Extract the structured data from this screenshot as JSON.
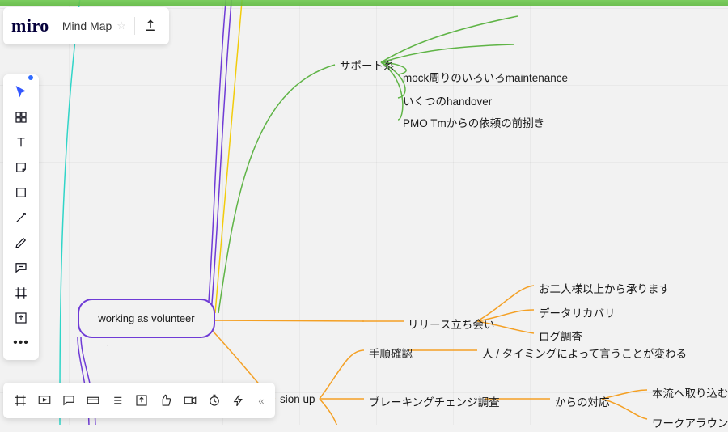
{
  "app": {
    "logo": "miro",
    "board_name": "Mind Map"
  },
  "colors": {
    "green": "#5fb446",
    "orange": "#f4a024",
    "purple": "#6f3bd6",
    "yellow": "#f2cc0c",
    "teal": "#30d5c8"
  },
  "root": {
    "label": "working as volunteer"
  },
  "support": {
    "label": "サポート系",
    "children": {
      "mock": "mock周りのいろいろmaintenance",
      "handover": "いくつのhandover",
      "pmo": "PMO Tmからの依頼の前捌き"
    }
  },
  "release": {
    "label": "リリース立ち会い",
    "children": {
      "two": "お二人様以上から承ります",
      "data": "データリカバリ",
      "log": "ログ調査"
    }
  },
  "procedure": {
    "label": "手順確認",
    "child": "人 / タイミングによって言うことが変わる"
  },
  "sion": {
    "label": "sion up"
  },
  "breaking": {
    "label": "ブレーキングチェンジ調査",
    "response": "からの対応",
    "children": {
      "mainline": "本流へ取り込む努力",
      "workaround": "ワークアラウンド対応"
    }
  }
}
